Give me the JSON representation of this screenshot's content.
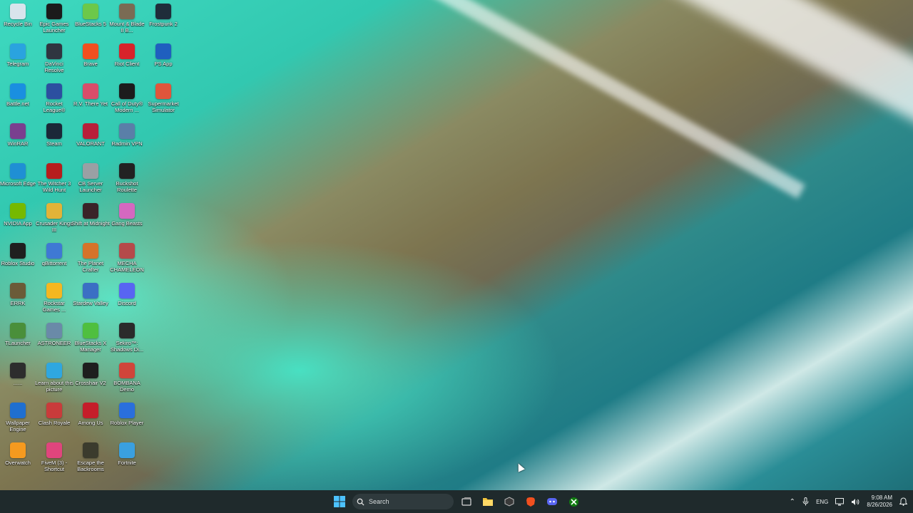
{
  "desktop": {
    "icons": [
      {
        "label": "Recycle Bin",
        "color": "#d9e4ec",
        "col": 0,
        "row": 0
      },
      {
        "label": "Epic Games Launcher",
        "color": "#1b1b1b",
        "col": 1,
        "row": 0
      },
      {
        "label": "BlueStacks 5",
        "color": "#6cc84a",
        "col": 2,
        "row": 0
      },
      {
        "label": "Mount & Blade II B...",
        "color": "#7a6b54",
        "col": 3,
        "row": 0
      },
      {
        "label": "Frostpunk 2",
        "color": "#1f2d3a",
        "col": 4,
        "row": 0
      },
      {
        "label": "Telegram",
        "color": "#2aa3df",
        "col": 0,
        "row": 1
      },
      {
        "label": "DaVinci Resolve",
        "color": "#2f3540",
        "col": 1,
        "row": 1
      },
      {
        "label": "Brave",
        "color": "#f1501f",
        "col": 2,
        "row": 1
      },
      {
        "label": "Riot Client",
        "color": "#d8232a",
        "col": 3,
        "row": 1
      },
      {
        "label": "PS App",
        "color": "#1f5fbf",
        "col": 4,
        "row": 1
      },
      {
        "label": "Battle.net",
        "color": "#1a8fe0",
        "col": 0,
        "row": 2
      },
      {
        "label": "Rocket League®",
        "color": "#2c4fa0",
        "col": 1,
        "row": 2
      },
      {
        "label": "R.V. There Yet",
        "color": "#d84d6a",
        "col": 2,
        "row": 2
      },
      {
        "label": "Call of Duty® Modern ...",
        "color": "#1c1c1c",
        "col": 3,
        "row": 2
      },
      {
        "label": "Supermarket Simulator",
        "color": "#e0553b",
        "col": 4,
        "row": 2
      },
      {
        "label": "WinRAR",
        "color": "#7a3f8f",
        "col": 0,
        "row": 3
      },
      {
        "label": "Steam",
        "color": "#1b2838",
        "col": 1,
        "row": 3
      },
      {
        "label": "VALORANT",
        "color": "#b81f3a",
        "col": 2,
        "row": 3
      },
      {
        "label": "Radmin VPN",
        "color": "#5a7fa8",
        "col": 3,
        "row": 3
      },
      {
        "label": "Microsoft Edge",
        "color": "#1f8fd4",
        "col": 0,
        "row": 4
      },
      {
        "label": "The Witcher 3 Wild Hunt",
        "color": "#b61d1d",
        "col": 1,
        "row": 4
      },
      {
        "label": "CB Server Launcher",
        "color": "#9aa0a4",
        "col": 2,
        "row": 4
      },
      {
        "label": "Buckshot Roulette",
        "color": "#222222",
        "col": 3,
        "row": 4
      },
      {
        "label": "NVIDIA App",
        "color": "#76b900",
        "col": 0,
        "row": 5
      },
      {
        "label": "Crusader Kings III",
        "color": "#e2b338",
        "col": 1,
        "row": 5
      },
      {
        "label": "Shift at Midnight",
        "color": "#3a2328",
        "col": 2,
        "row": 5
      },
      {
        "label": "Gang Beasts",
        "color": "#d468c0",
        "col": 3,
        "row": 5
      },
      {
        "label": "Roblox Studio",
        "color": "#1f1f1f",
        "col": 0,
        "row": 6
      },
      {
        "label": "qBittorrent",
        "color": "#3f79d4",
        "col": 1,
        "row": 6
      },
      {
        "label": "The Planet Crafter",
        "color": "#d5732a",
        "col": 2,
        "row": 6
      },
      {
        "label": "MECHA CHAMELEON",
        "color": "#b54a4a",
        "col": 3,
        "row": 6
      },
      {
        "label": "ERRK",
        "color": "#6b5b38",
        "col": 0,
        "row": 7
      },
      {
        "label": "Rockstar Games ...",
        "color": "#f5b720",
        "col": 1,
        "row": 7
      },
      {
        "label": "Stardew Valley",
        "color": "#3b6fc4",
        "col": 2,
        "row": 7
      },
      {
        "label": "Discord",
        "color": "#5865f2",
        "col": 3,
        "row": 7
      },
      {
        "label": "TLauncher",
        "color": "#4a8f3a",
        "col": 0,
        "row": 8
      },
      {
        "label": "ASTRONEER",
        "color": "#6a8aa8",
        "col": 1,
        "row": 8
      },
      {
        "label": "BlueStacks X Manager",
        "color": "#4fbf3f",
        "col": 2,
        "row": 8
      },
      {
        "label": "Sekiro™: Shadows Di...",
        "color": "#2b2b2b",
        "col": 3,
        "row": 8
      },
      {
        "label": "......",
        "color": "#2d2d2d",
        "col": 0,
        "row": 9
      },
      {
        "label": "Learn about this picture",
        "color": "#2fa7e0",
        "col": 1,
        "row": 9
      },
      {
        "label": "Crosshair V2",
        "color": "#1e1e1e",
        "col": 2,
        "row": 9
      },
      {
        "label": "BOMBANA Demo",
        "color": "#d0453a",
        "col": 3,
        "row": 9
      },
      {
        "label": "Wallpaper Engine",
        "color": "#1f6fd0",
        "col": 0,
        "row": 10
      },
      {
        "label": "Clash Royale",
        "color": "#c93b3b",
        "col": 1,
        "row": 10
      },
      {
        "label": "Among Us",
        "color": "#c51d2a",
        "col": 2,
        "row": 10
      },
      {
        "label": "Roblox Player",
        "color": "#2a6fdc",
        "col": 3,
        "row": 10
      },
      {
        "label": "Overwatch",
        "color": "#f59a1f",
        "col": 0,
        "row": 11
      },
      {
        "label": "FiveM (3) - Shortcut",
        "color": "#e0457d",
        "col": 1,
        "row": 11
      },
      {
        "label": "Escape the Backrooms",
        "color": "#3b3b2d",
        "col": 2,
        "row": 11
      },
      {
        "label": "Fortnite",
        "color": "#3aa0e0",
        "col": 3,
        "row": 11
      }
    ]
  },
  "taskbar": {
    "search_placeholder": "Search",
    "pinned": [
      {
        "name": "start-button",
        "color": "#3aa0f0"
      },
      {
        "name": "task-view-button",
        "color": "#d0d0d0"
      },
      {
        "name": "file-explorer-button",
        "color": "#f2c53d"
      },
      {
        "name": "app-dark-button",
        "color": "#404040"
      },
      {
        "name": "brave-button",
        "color": "#f1501f"
      },
      {
        "name": "discord-button",
        "color": "#5865f2"
      },
      {
        "name": "xbox-button",
        "color": "#107c10"
      }
    ],
    "tray": {
      "language": "ENG",
      "time": "9:08 AM",
      "date": "8/26/2026"
    }
  }
}
